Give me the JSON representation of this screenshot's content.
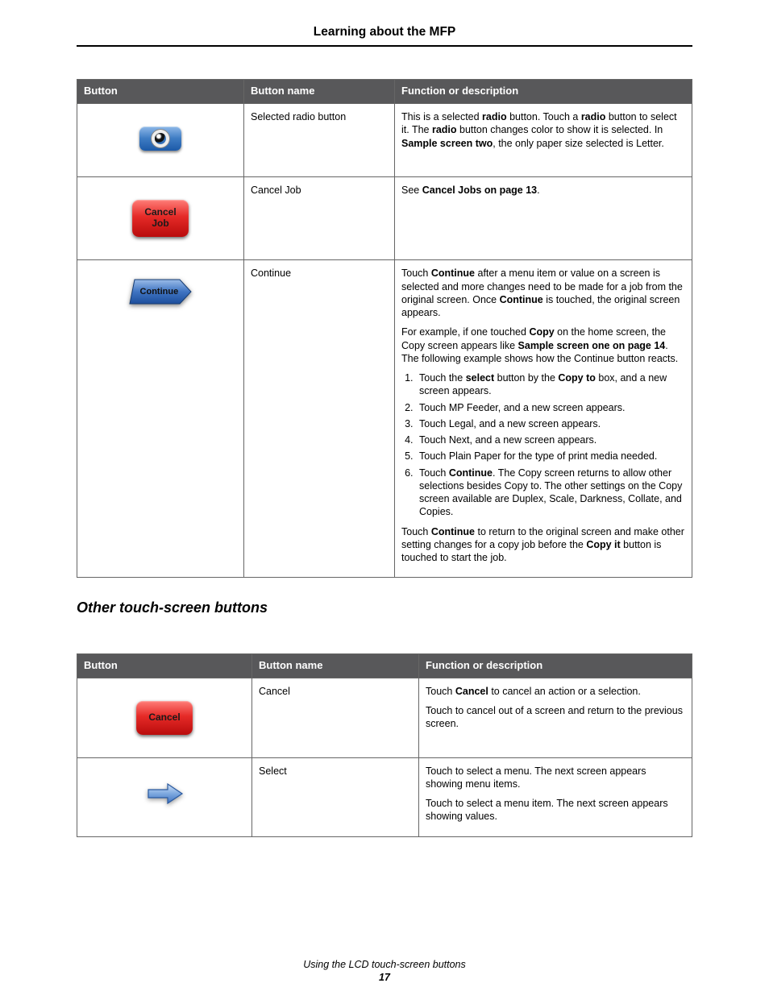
{
  "header": {
    "title": "Learning about the MFP"
  },
  "table1": {
    "headers": {
      "button": "Button",
      "name": "Button name",
      "desc": "Function or description"
    },
    "rows": [
      {
        "icon": "radio",
        "name": "Selected radio button",
        "desc_html": "This is a selected <b>radio</b> button. Touch a <b>radio</b> button to select it. The <b>radio</b> button changes color to show it is selected. In <b>Sample screen two</b>, the only paper size selected is Letter."
      },
      {
        "icon": "cancel-job",
        "icon_label": "Cancel\nJob",
        "name": "Cancel Job",
        "desc_html": "See <b>Cancel Jobs on page 13</b>."
      },
      {
        "icon": "continue",
        "icon_label": "Continue",
        "name": "Continue",
        "desc_p1_html": "Touch <b>Continue</b> after a menu item or value on a screen is selected and more changes need to be made for a job from the original screen. Once <b>Continue</b> is touched, the original screen appears.",
        "desc_p2_html": "For example, if one touched <b>Copy</b> on the home screen, the Copy screen appears like <b>Sample screen one on page 14</b>. The following example shows how the Continue button reacts.",
        "steps": [
          "Touch the <b>select</b> button by the <b>Copy to</b> box, and a new screen appears.",
          "Touch MP Feeder, and a new screen appears.",
          "Touch Legal, and a new screen appears.",
          "Touch Next, and a new screen appears.",
          "Touch Plain Paper for the type of print media needed.",
          "Touch <b>Continue</b>. The Copy screen returns to allow other selections besides Copy to. The other settings on the Copy screen available are Duplex, Scale, Darkness, Collate, and Copies."
        ],
        "desc_p3_html": "Touch <b>Continue</b> to return to the original screen and make other setting changes for a copy job before the <b>Copy it</b> button is touched to start the job."
      }
    ]
  },
  "section_heading": "Other touch-screen buttons",
  "table2": {
    "headers": {
      "button": "Button",
      "name": "Button name",
      "desc": "Function or description"
    },
    "rows": [
      {
        "icon": "cancel",
        "icon_label": "Cancel",
        "name": "Cancel",
        "desc_p1_html": "Touch <b>Cancel</b> to cancel an action or a selection.",
        "desc_p2": "Touch to cancel out of a screen and return to the previous screen."
      },
      {
        "icon": "arrow",
        "name": "Select",
        "desc_p1": "Touch to select a menu. The next screen appears showing menu items.",
        "desc_p2": "Touch to select a menu item. The next screen appears showing values."
      }
    ]
  },
  "footer": {
    "title": "Using the LCD touch-screen buttons",
    "page": "17"
  }
}
